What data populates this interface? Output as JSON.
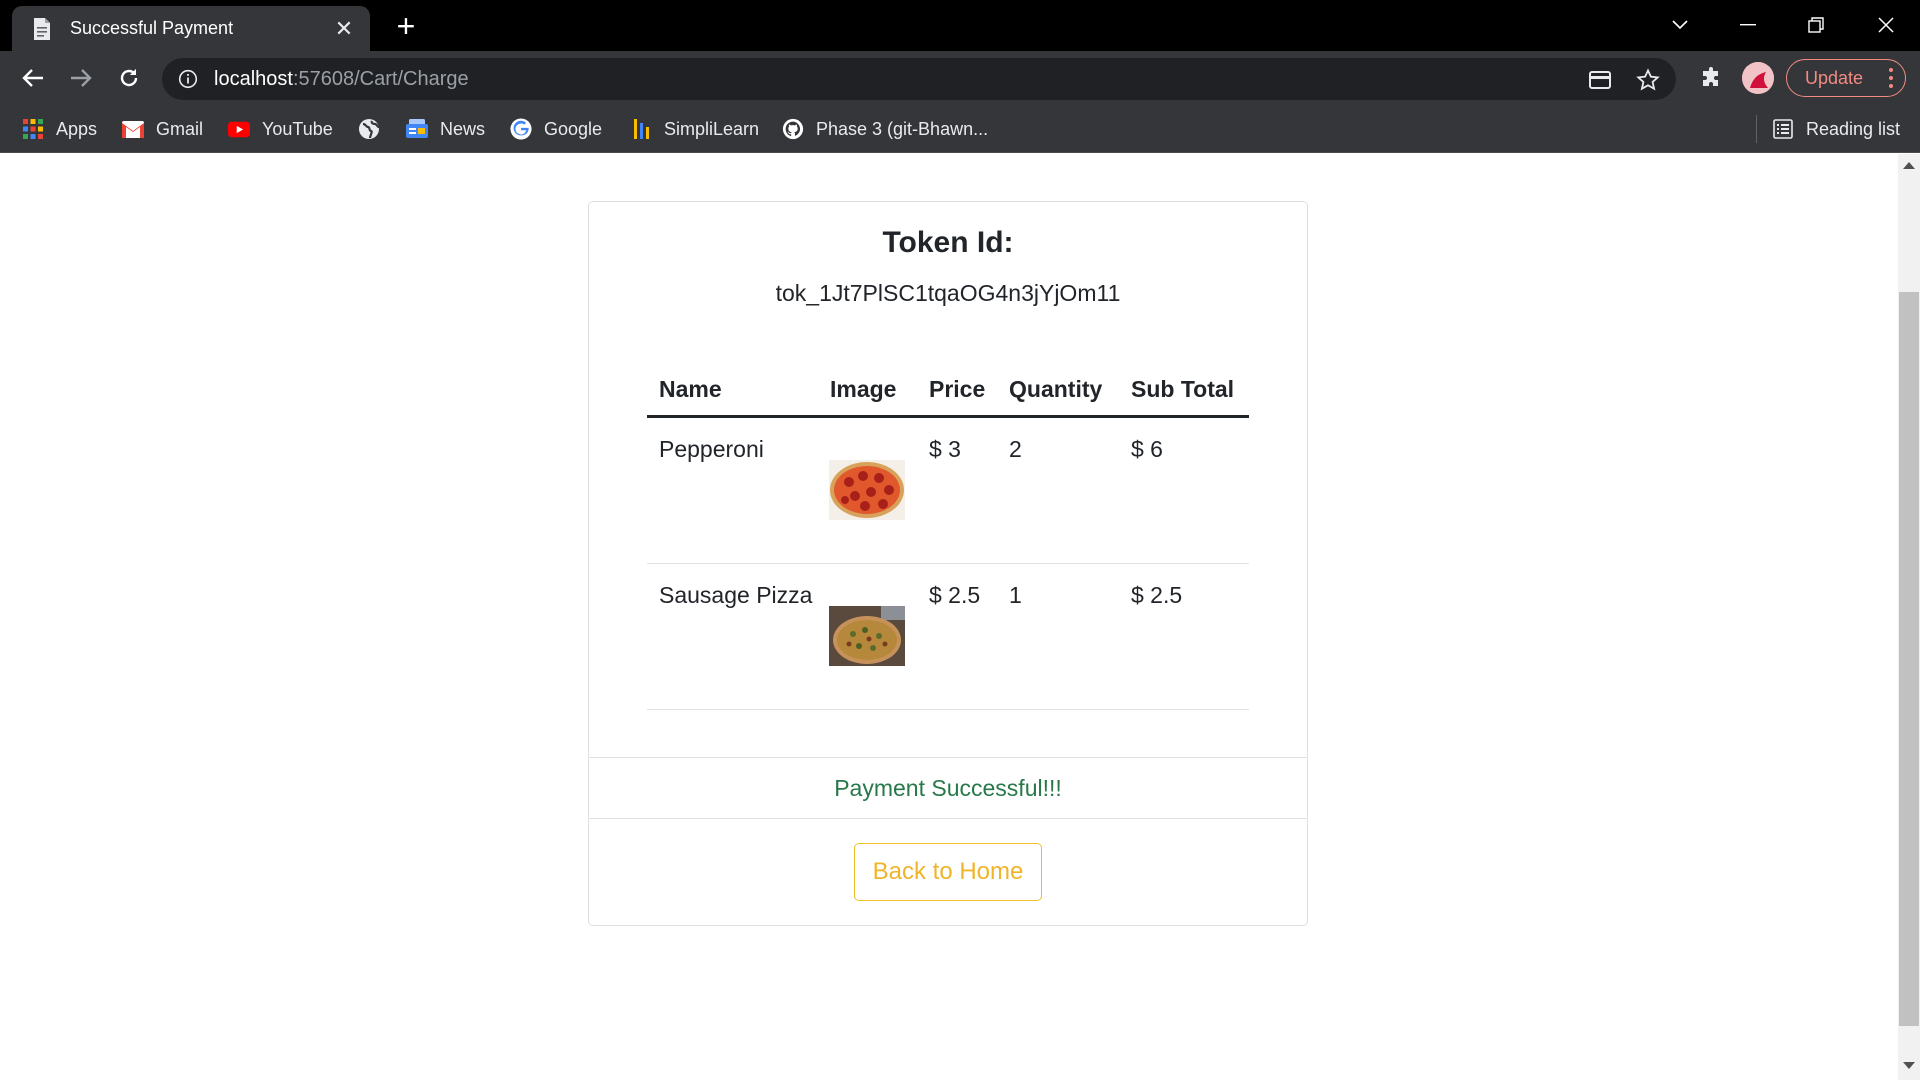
{
  "browser": {
    "tab": {
      "title": "Successful Payment",
      "close_glyph": "✕"
    },
    "newtab_glyph": "+",
    "address": {
      "host": "localhost",
      "rest": ":57608/Cart/Charge"
    },
    "update_label": "Update",
    "bookmarks": [
      {
        "label": "Apps",
        "icon": "apps-grid-icon"
      },
      {
        "label": "Gmail",
        "icon": "gmail-icon"
      },
      {
        "label": "YouTube",
        "icon": "youtube-icon"
      },
      {
        "label": "",
        "icon": "globe-icon"
      },
      {
        "label": "News",
        "icon": "news-icon"
      },
      {
        "label": "Google",
        "icon": "google-icon"
      },
      {
        "label": "SimpliLearn",
        "icon": "simplilearn-icon"
      },
      {
        "label": "Phase 3 (git-Bhawn...",
        "icon": "github-icon"
      }
    ],
    "reading_list_label": "Reading list"
  },
  "page": {
    "token_title": "Token Id:",
    "token_value": "tok_1Jt7PlSC1tqaOG4n3jYjOm11",
    "table": {
      "headers": [
        "Name",
        "Image",
        "Price",
        "Quantity",
        "Sub Total"
      ],
      "rows": [
        {
          "name": "Pepperoni",
          "image": "pepperoni-pizza-image",
          "price": "$ 3",
          "quantity": "2",
          "subtotal": "$ 6"
        },
        {
          "name": "Sausage Pizza",
          "image": "sausage-pizza-image",
          "price": "$ 2.5",
          "quantity": "1",
          "subtotal": "$ 2.5"
        }
      ]
    },
    "status": "Payment Successful!!!",
    "back_button": "Back to Home"
  },
  "colors": {
    "chrome_dark": "#35363a",
    "omnibox": "#202124",
    "success_text": "#28784a",
    "warning_button": "#f0b429",
    "update_accent": "#f28b82"
  }
}
